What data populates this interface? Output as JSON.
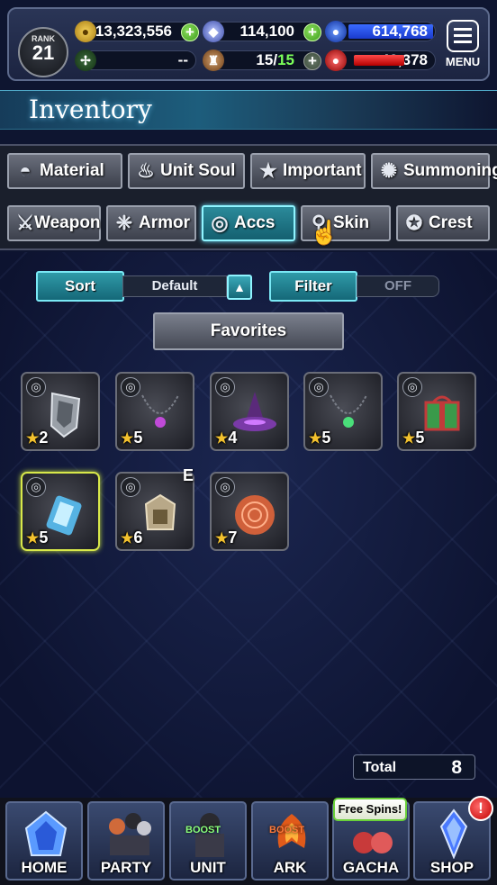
{
  "status": {
    "rank_label": "RANK",
    "rank_value": "21",
    "gil": "13,323,556",
    "lapis": "114,100",
    "energy": "614,768",
    "unknown": "--",
    "capacity": "15",
    "capacity_max": "15",
    "arena": "43,378",
    "menu_label": "MENU"
  },
  "header": {
    "title": "Inventory"
  },
  "tabs_row1": [
    {
      "label": "Material",
      "icon": "material-icon"
    },
    {
      "label": "Unit Soul",
      "icon": "unit-soul-icon"
    },
    {
      "label": "Important",
      "icon": "star-icon"
    },
    {
      "label": "Summoning",
      "icon": "summoning-icon"
    }
  ],
  "tabs_row2": [
    {
      "label": "Weapon",
      "icon": "weapon-icon"
    },
    {
      "label": "Armor",
      "icon": "armor-icon"
    },
    {
      "label": "Accs",
      "icon": "accessory-icon",
      "active": true
    },
    {
      "label": "Skin",
      "icon": "skin-icon"
    },
    {
      "label": "Crest",
      "icon": "crest-icon"
    }
  ],
  "controls": {
    "sort_label": "Sort",
    "sort_value": "Default",
    "filter_label": "Filter",
    "filter_value": "OFF",
    "favorites_label": "Favorites"
  },
  "items": [
    {
      "name": "shield-accessory",
      "stars": "2"
    },
    {
      "name": "necklace-accessory",
      "stars": "5"
    },
    {
      "name": "witch-hat-accessory",
      "stars": "4"
    },
    {
      "name": "necklace-accessory",
      "stars": "5"
    },
    {
      "name": "gift-box-accessory",
      "stars": "5"
    },
    {
      "name": "crystal-accessory",
      "stars": "5"
    },
    {
      "name": "armor-set-accessory",
      "stars": "6",
      "equipped": "E"
    },
    {
      "name": "orb-accessory",
      "stars": "7"
    }
  ],
  "total": {
    "label": "Total",
    "value": "8"
  },
  "nav": [
    {
      "label": "HOME"
    },
    {
      "label": "PARTY"
    },
    {
      "label": "UNIT",
      "boost": "BOOST"
    },
    {
      "label": "ARK",
      "boost": "BOOST"
    },
    {
      "label": "GACHA",
      "promo": "Free Spins!"
    },
    {
      "label": "SHOP",
      "alert": "!"
    }
  ],
  "colors": {
    "accent_teal": "#2f9aa8",
    "panel": "#1c2441",
    "star": "#f2c12e"
  }
}
